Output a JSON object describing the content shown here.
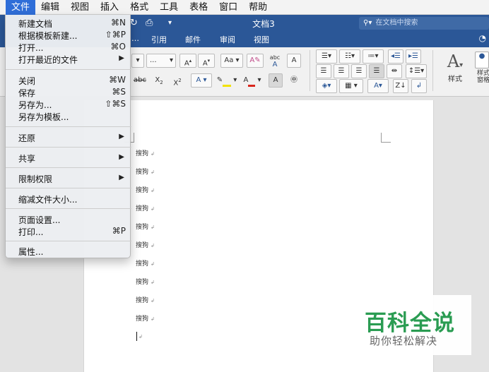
{
  "menubar": {
    "items": [
      "文件",
      "编辑",
      "视图",
      "插入",
      "格式",
      "工具",
      "表格",
      "窗口",
      "帮助"
    ]
  },
  "titlebar": {
    "doc_title": "文档3",
    "search_placeholder": "在文档中搜索"
  },
  "ribbon": {
    "tabs": [
      "引用",
      "邮件",
      "审阅",
      "视图"
    ],
    "font_size": "...",
    "styles_label": "样式",
    "styles_pane_label": "样式\n窗格"
  },
  "document": {
    "lines": [
      "搜狗",
      "搜狗",
      "搜狗",
      "搜狗",
      "搜狗",
      "搜狗",
      "搜狗",
      "搜狗",
      "搜狗",
      "搜狗"
    ]
  },
  "file_menu": {
    "items": [
      {
        "label": "新建文档",
        "shortcut": "⌘N"
      },
      {
        "label": "根据模板新建...",
        "shortcut": "⇧⌘P"
      },
      {
        "label": "打开...",
        "shortcut": "⌘O"
      },
      {
        "label": "打开最近的文件",
        "submenu": true
      },
      {
        "label": "关闭",
        "shortcut": "⌘W"
      },
      {
        "label": "保存",
        "shortcut": "⌘S"
      },
      {
        "label": "另存为...",
        "shortcut": "⇧⌘S"
      },
      {
        "label": "另存为模板..."
      },
      {
        "label": "还原",
        "submenu": true
      },
      {
        "label": "共享",
        "submenu": true
      },
      {
        "label": "限制权限",
        "submenu": true
      },
      {
        "label": "缩减文件大小..."
      },
      {
        "label": "页面设置..."
      },
      {
        "label": "打印...",
        "shortcut": "⌘P"
      },
      {
        "label": "属性..."
      }
    ]
  },
  "watermark": {
    "title": "百科全说",
    "subtitle": "助你轻松解决"
  }
}
